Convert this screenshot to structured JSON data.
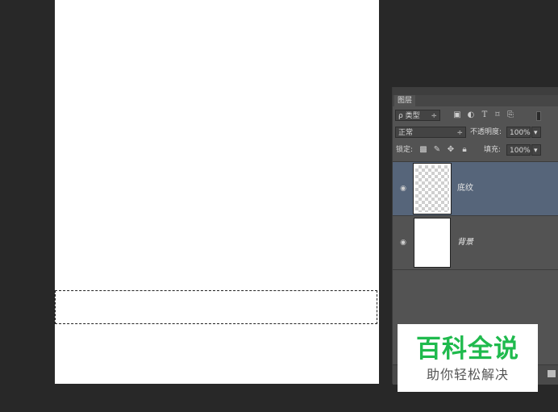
{
  "panel": {
    "tab_label": "图层",
    "filter": {
      "label": "ρ 类型",
      "arrow": "÷"
    },
    "blend": {
      "mode": "正常",
      "arrow": "÷",
      "opacity_label": "不透明度:",
      "opacity_value": "100%",
      "opacity_arrow": "▾"
    },
    "lock": {
      "label": "锁定:",
      "fill_label": "填充:",
      "fill_value": "100%",
      "fill_arrow": "▾"
    },
    "layers": [
      {
        "name": "底纹",
        "visible_icon": "eye-icon",
        "thumb": "transparent",
        "active": true
      },
      {
        "name": "背景",
        "visible_icon": "eye-icon",
        "thumb": "white",
        "active": false
      }
    ],
    "highlight_color": "#56657a"
  },
  "watermark": {
    "title": "百科全说",
    "subtitle": "助你轻松解决",
    "title_color": "#1fba4d"
  }
}
